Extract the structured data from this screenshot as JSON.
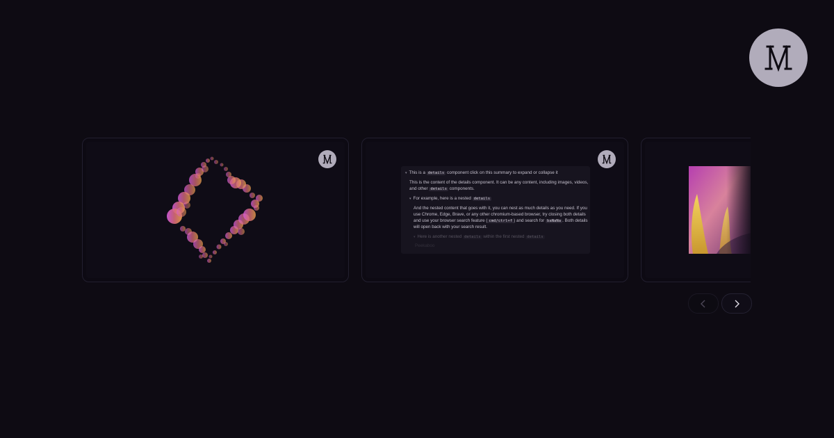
{
  "brand": {
    "logo_text": "M",
    "logo_color": "#b1acbb"
  },
  "carousel": {
    "cards": [
      {
        "name": "sparkle-animation",
        "badge_icon": "m-logo-icon"
      },
      {
        "name": "details-component-demo",
        "badge_icon": "m-logo-icon",
        "details": {
          "summary_prefix": "This is a",
          "summary_code": "details",
          "summary_suffix": "component click on this summary to expand or collapse it",
          "content_line1": "This is the content of the details component. It can be any content, including images, videos,",
          "content_line2_prefix": "and other",
          "content_line2_code": "details",
          "content_line2_suffix": "components.",
          "nested_summary_prefix": "For example, here is a nested",
          "nested_summary_code": "details",
          "nested_line1": "And the nested content that goes with it, you can nest as much details as you need. If you",
          "nested_line2": "use Chrome, Edge, Brave, or any other chromium-based browser, try closing both details",
          "nested_line3_prefix": "and use your browser search feature (",
          "nested_line3_code": "cmd/ctrl+f",
          "nested_line3_mid": ") and search for",
          "nested_line3_code2": "baNaNa",
          "nested_line3_suffix": ". Both details",
          "nested_line4": "will open back with your search result.",
          "deep_summary_prefix": "Here is another nested",
          "deep_summary_code": "details",
          "deep_summary_mid": "within the first nested",
          "deep_summary_code2": "details",
          "deep_content": "Peekaboo"
        }
      },
      {
        "name": "flower-photo",
        "image_desc_icon": "flower-image-icon"
      }
    ]
  },
  "navigation": {
    "prev_icon": "chevron-left-icon",
    "next_icon": "chevron-right-icon"
  },
  "colors": {
    "background": "#0e0b13",
    "card_border": "#221f2f",
    "accent_pink": "#d45bd8",
    "accent_orange": "#e8a24a"
  }
}
